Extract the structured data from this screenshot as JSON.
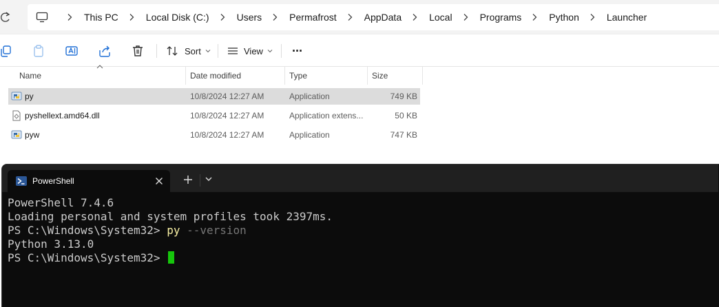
{
  "explorer": {
    "breadcrumbs": [
      "This PC",
      "Local Disk (C:)",
      "Users",
      "Permafrost",
      "AppData",
      "Local",
      "Programs",
      "Python",
      "Launcher"
    ],
    "toolbar": {
      "sort_label": "Sort",
      "view_label": "View",
      "more_label": "···"
    },
    "columns": {
      "name": "Name",
      "date": "Date modified",
      "type": "Type",
      "size": "Size"
    },
    "files": [
      {
        "name": "py",
        "date": "10/8/2024 12:27 AM",
        "type": "Application",
        "size": "749 KB",
        "icon": "python-app-icon",
        "selected": true
      },
      {
        "name": "pyshellext.amd64.dll",
        "date": "10/8/2024 12:27 AM",
        "type": "Application extens...",
        "size": "50 KB",
        "icon": "dll-file-icon",
        "selected": false
      },
      {
        "name": "pyw",
        "date": "10/8/2024 12:27 AM",
        "type": "Application",
        "size": "747 KB",
        "icon": "python-app-icon",
        "selected": false
      }
    ]
  },
  "terminal": {
    "tab_title": "PowerShell",
    "lines": {
      "l1": "PowerShell 7.4.6",
      "l2": "Loading personal and system profiles took 2397ms.",
      "l3_prompt": "PS C:\\Windows\\System32> ",
      "l3_cmd": "py",
      "l3_arg": " --version",
      "l4": "Python 3.13.0",
      "l5_prompt": "PS C:\\Windows\\System32> "
    },
    "colors": {
      "background": "#0c0c0c",
      "command": "#f9f1a5",
      "argument": "#767676",
      "cursor": "#16c60c"
    }
  }
}
